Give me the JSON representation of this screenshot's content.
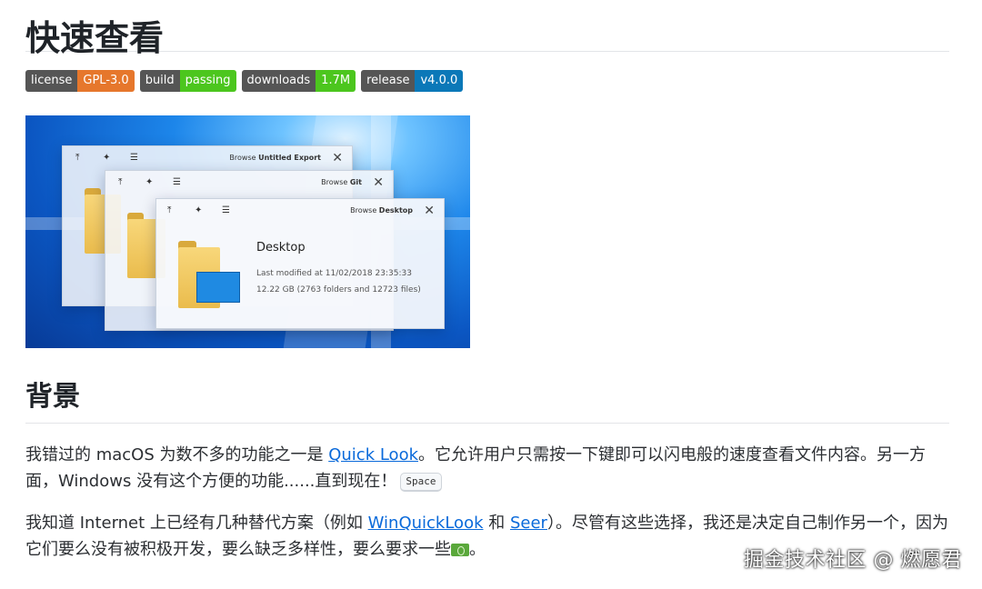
{
  "title": "快速查看",
  "badges": [
    {
      "label": "license",
      "value": "GPL-3.0",
      "color": "#e6772c"
    },
    {
      "label": "build",
      "value": "passing",
      "color": "#4cc61e"
    },
    {
      "label": "downloads",
      "value": "1.7M",
      "color": "#4cc61e"
    },
    {
      "label": "release",
      "value": "v4.0.0",
      "color": "#0b78b8"
    }
  ],
  "screenshot": {
    "windows": [
      {
        "browse_prefix": "Browse",
        "browse_name": "Untitled Export",
        "close": "✕"
      },
      {
        "browse_prefix": "Browse",
        "browse_name": "Git",
        "close": "✕"
      },
      {
        "browse_prefix": "Browse",
        "browse_name": "Desktop",
        "close": "✕"
      }
    ],
    "file_name": "Desktop",
    "last_modified": "Last modified at 11/02/2018 23:35:33",
    "size_info": "12.22 GB (2763 folders and 12723 files)",
    "toolbar_icons": [
      "pin-top-icon",
      "pushpin-icon",
      "open-with-icon"
    ]
  },
  "section": {
    "heading": "背景"
  },
  "p1": {
    "a": "我错过的 macOS 为数不多的功能之一是 ",
    "link": "Quick Look",
    "b": "。它允许用户只需按一下键即可以闪电般的速度查看文件内容。另一方面，Windows 没有这个方便的功能......直到现在！",
    "kbd": "Space"
  },
  "p2": {
    "a": "我知道 Internet 上已经有几种替代方案（例如 ",
    "link1": "WinQuickLook",
    "mid": " 和 ",
    "link2": "Seer",
    "b": "）。尽管有这些选择，我还是决定自己制作另一个，因为它们要么没有被积极开发，要么缺乏多样性，要么要求一些",
    "emoji": "money-icon",
    "c": "。"
  },
  "watermark": "掘金技术社区 @ 燃愿君"
}
